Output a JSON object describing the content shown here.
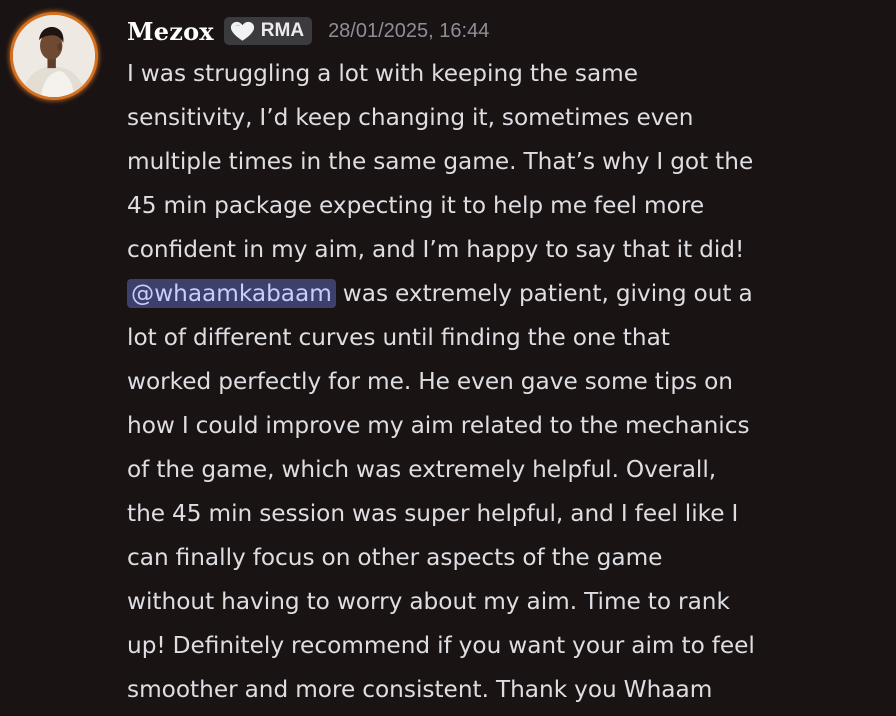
{
  "message": {
    "author": "Mezox",
    "tag": {
      "icon": "heart-icon",
      "label": "RMA"
    },
    "timestamp": "28/01/2025, 16:44",
    "lines": [
      "I was struggling a lot with keeping the same",
      "sensitivity, I’d keep changing it, sometimes even",
      "multiple times in the same game. That’s why I got the",
      "45 min package expecting it to help me feel more",
      "confident in my aim, and I’m happy to say that it did!",
      {
        "mention": "@whaamkabaam",
        "after": " was extremely patient, giving out a"
      },
      "lot of different curves until finding the one that",
      "worked perfectly for me. He even gave some tips on",
      "how I could improve my aim related to the mechanics",
      "of the game, which was extremely helpful. Overall,",
      "the 45 min session was super helpful, and I feel like I",
      "can finally focus on other aspects of the game",
      "without having to worry about my aim. Time to rank",
      "up! Definitely recommend if you want your aim to feel",
      "smoother and more consistent. Thank you Whaam"
    ]
  },
  "colors": {
    "background": "#1a1314",
    "avatar_ring": "#d5701f",
    "mention_bg": "#3d406b",
    "mention_text": "#c9cdfb"
  }
}
